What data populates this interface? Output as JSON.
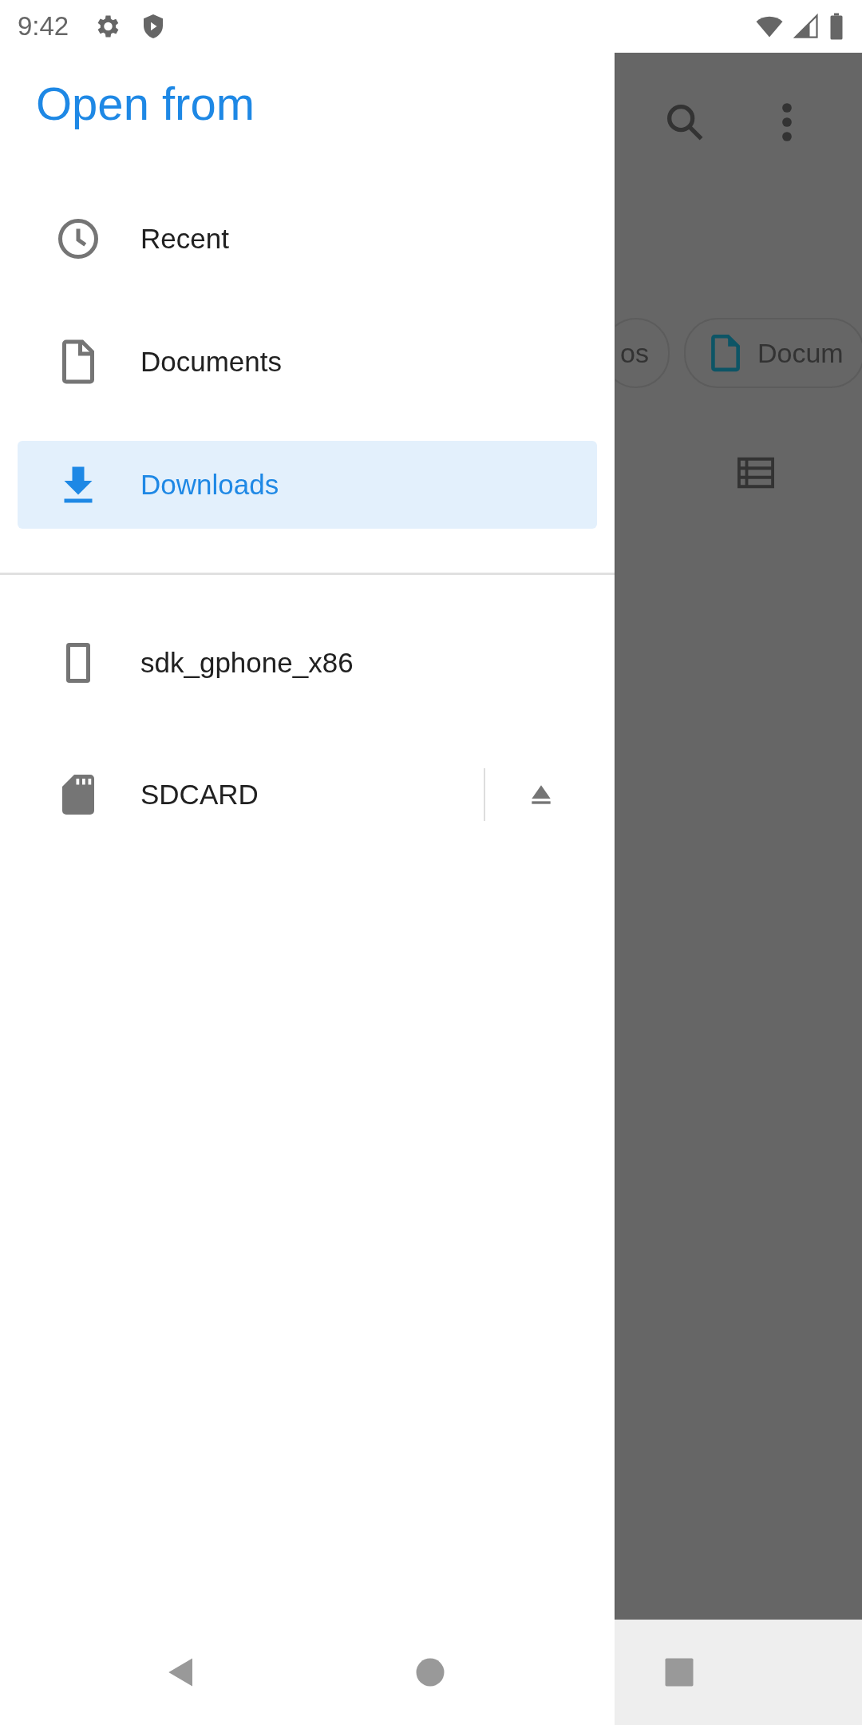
{
  "status_bar": {
    "time": "9:42"
  },
  "drawer": {
    "title": "Open from",
    "items": [
      {
        "label": "Recent",
        "kind": "clock",
        "selected": false
      },
      {
        "label": "Documents",
        "kind": "file",
        "selected": false
      },
      {
        "label": "Downloads",
        "kind": "download",
        "selected": true
      }
    ],
    "roots": [
      {
        "label": "sdk_gphone_x86",
        "kind": "phone",
        "ejectable": false
      },
      {
        "label": "SDCARD",
        "kind": "sdcard",
        "ejectable": true
      }
    ]
  },
  "background": {
    "chips": [
      {
        "label": "os",
        "kind": "plain"
      },
      {
        "label": "Docum",
        "kind": "file"
      }
    ]
  }
}
